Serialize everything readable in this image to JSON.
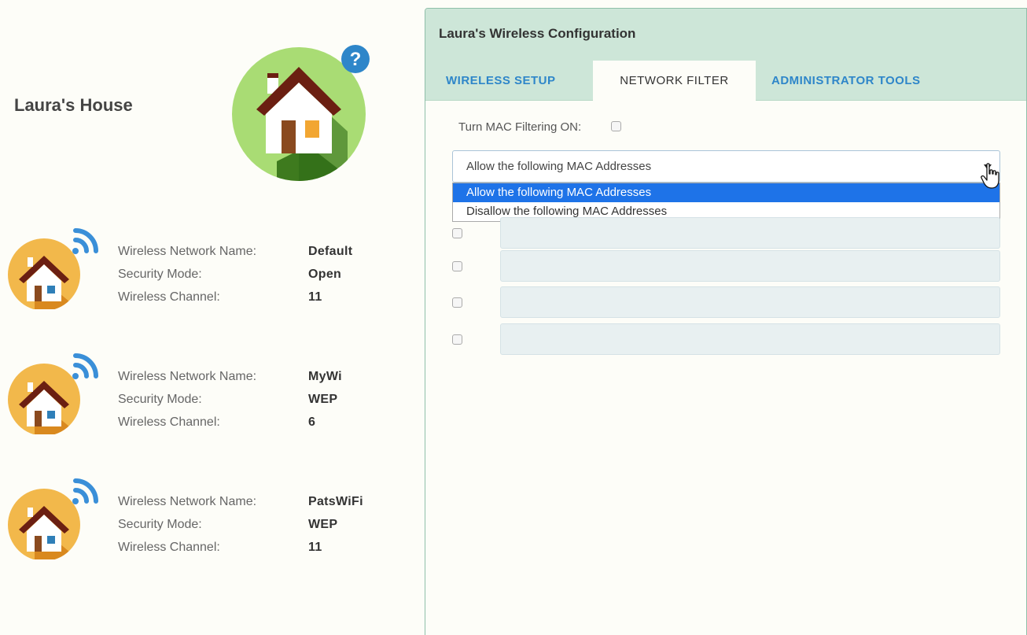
{
  "left": {
    "house_title": "Laura's House",
    "networks": [
      {
        "name_label": "Wireless Network Name:",
        "name": "Default",
        "security_label": "Security Mode:",
        "security": "Open",
        "channel_label": "Wireless Channel:",
        "channel": "11"
      },
      {
        "name_label": "Wireless Network Name:",
        "name": "MyWi",
        "security_label": "Security Mode:",
        "security": "WEP",
        "channel_label": "Wireless Channel:",
        "channel": "6"
      },
      {
        "name_label": "Wireless Network Name:",
        "name": "PatsWiFi",
        "security_label": "Security Mode:",
        "security": "WEP",
        "channel_label": "Wireless Channel:",
        "channel": "11"
      }
    ],
    "help_icon_glyph": "?"
  },
  "panel": {
    "title": "Laura's Wireless Configuration",
    "tabs": [
      {
        "label": "WIRELESS SETUP",
        "active": false
      },
      {
        "label": "NETWORK FILTER",
        "active": true
      },
      {
        "label": "ADMINISTRATOR TOOLS",
        "active": false
      }
    ],
    "mac_filter_label": "Turn MAC Filtering ON:",
    "select_value": "Allow the following MAC Addresses",
    "dropdown_options": [
      {
        "label": "Allow the following MAC Addresses",
        "selected": true
      },
      {
        "label": "Disallow the following MAC Addresses",
        "selected": false
      }
    ]
  },
  "colors": {
    "accent_tab": "#2e86c9",
    "panel_header": "#cde6d8",
    "dropdown_selected": "#1e73e8",
    "house_roof": "#6b1f12",
    "house_circle_green": "#9ed36a",
    "house_circle_orange": "#f2b84b",
    "wifi_blue": "#3a8fd8"
  }
}
